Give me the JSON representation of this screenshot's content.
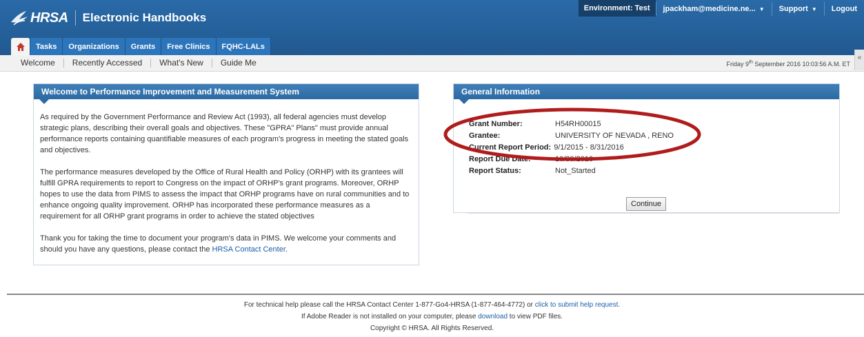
{
  "header": {
    "brand": "HRSA",
    "app_title": "Electronic Handbooks",
    "environment": "Environment: Test",
    "user": "jpackham@medicine.ne...",
    "support": "Support",
    "logout": "Logout"
  },
  "tabs": [
    {
      "label": "Home",
      "icon": "home-icon"
    },
    {
      "label": "Tasks"
    },
    {
      "label": "Organizations"
    },
    {
      "label": "Grants"
    },
    {
      "label": "Free Clinics"
    },
    {
      "label": "FQHC-LALs"
    }
  ],
  "subnav": {
    "items": [
      "Welcome",
      "Recently Accessed",
      "What's New",
      "Guide Me"
    ],
    "date_prefix": "Friday 9",
    "date_sup": "th",
    "date_suffix": " September 2016 10:03:56 A.M. ET"
  },
  "welcome": {
    "title": "Welcome to Performance Improvement and Measurement System",
    "p1": "As required by the Government Performance and Review Act (1993), all federal agencies must develop strategic plans, describing their overall goals and objectives. These \"GPRA\" Plans\" must provide annual performance reports containing quantifiable measures of each program's progress in meeting the stated goals and objectives.",
    "p2": "The performance measures developed by the Office of Rural Health and Policy (ORHP) with its grantees will fulfill GPRA requirements to report to Congress on the impact of ORHP's grant programs. Moreover, ORHP hopes to use the data from PIMS to assess the impact that ORHP programs have on rural communities and to enhance ongoing quality improvement. ORHP has incorporated these performance measures as a requirement for all ORHP grant programs in order to achieve the stated objectives",
    "p3": "Thank you for taking the time to document your program's data in PIMS. We welcome your comments and should you have any questions, please contact the ",
    "p3_link": "HRSA Contact Center",
    "p3_end": "."
  },
  "general_info": {
    "title": "General Information",
    "rows": [
      {
        "label": "Grant Number:",
        "value": "H54RH00015"
      },
      {
        "label": "Grantee:",
        "value": "UNIVERSITY OF NEVADA , RENO"
      },
      {
        "label": "Current Report Period:",
        "value": "9/1/2015 - 8/31/2016"
      },
      {
        "label": "Report Due Date:",
        "value": "10/30/2016"
      },
      {
        "label": "Report Status:",
        "value": "Not_Started"
      }
    ],
    "continue_label": "Continue",
    "highlight_color": "#b01c1c"
  },
  "footer": {
    "line1": "For technical help please call the HRSA Contact Center 1-877-Go4-HRSA (1-877-464-4772) or ",
    "line1_link": "click to submit help request.",
    "line2_pre": "If Adobe Reader is not installed on your computer, please ",
    "line2_link": "download",
    "line2_post": " to view PDF files.",
    "line3": "Copyright © HRSA. All Rights Reserved."
  },
  "colors": {
    "header_blue": "#2a6aa8",
    "panel_blue": "#3a7ab4",
    "link": "#1a5fa8"
  }
}
